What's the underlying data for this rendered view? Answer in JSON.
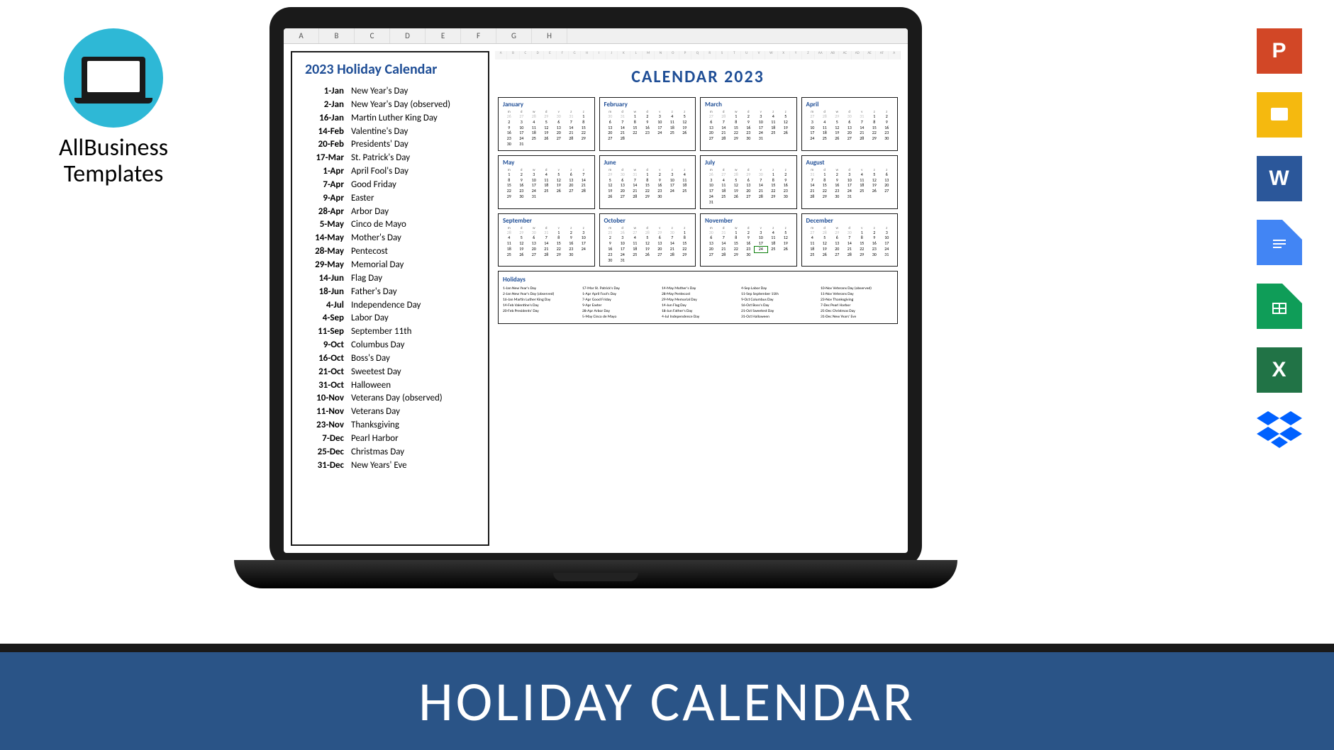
{
  "logo": {
    "line1": "AllBusiness",
    "line2": "Templates"
  },
  "banner": "HOLIDAY CALENDAR",
  "col_headers": [
    "A",
    "B",
    "C",
    "D",
    "E",
    "F",
    "G",
    "H"
  ],
  "holiday_panel": {
    "title": "2023 Holiday Calendar",
    "items": [
      {
        "date": "1-Jan",
        "name": "New Year's Day"
      },
      {
        "date": "2-Jan",
        "name": "New Year's Day (observed)"
      },
      {
        "date": "16-Jan",
        "name": "Martin Luther King Day"
      },
      {
        "date": "14-Feb",
        "name": "Valentine's Day"
      },
      {
        "date": "20-Feb",
        "name": "Presidents' Day"
      },
      {
        "date": "17-Mar",
        "name": "St. Patrick's Day"
      },
      {
        "date": "1-Apr",
        "name": "April Fool's Day"
      },
      {
        "date": "7-Apr",
        "name": "Good Friday"
      },
      {
        "date": "9-Apr",
        "name": "Easter"
      },
      {
        "date": "28-Apr",
        "name": "Arbor Day"
      },
      {
        "date": "5-May",
        "name": "Cinco de Mayo"
      },
      {
        "date": "14-May",
        "name": "Mother's Day"
      },
      {
        "date": "28-May",
        "name": "Pentecost"
      },
      {
        "date": "29-May",
        "name": "Memorial Day"
      },
      {
        "date": "14-Jun",
        "name": "Flag Day"
      },
      {
        "date": "18-Jun",
        "name": "Father's Day"
      },
      {
        "date": "4-Jul",
        "name": "Independence Day"
      },
      {
        "date": "4-Sep",
        "name": "Labor Day"
      },
      {
        "date": "11-Sep",
        "name": "September 11th"
      },
      {
        "date": "9-Oct",
        "name": "Columbus Day"
      },
      {
        "date": "16-Oct",
        "name": "Boss's Day"
      },
      {
        "date": "21-Oct",
        "name": "Sweetest Day"
      },
      {
        "date": "31-Oct",
        "name": "Halloween"
      },
      {
        "date": "10-Nov",
        "name": "Veterans Day (observed)"
      },
      {
        "date": "11-Nov",
        "name": "Veterans Day"
      },
      {
        "date": "23-Nov",
        "name": "Thanksgiving"
      },
      {
        "date": "7-Dec",
        "name": "Pearl Harbor"
      },
      {
        "date": "25-Dec",
        "name": "Christmas Day"
      },
      {
        "date": "31-Dec",
        "name": "New Years' Eve"
      }
    ]
  },
  "calendar": {
    "title": "CALENDAR 2023",
    "mini_cols": [
      "A",
      "B",
      "C",
      "D",
      "E",
      "F",
      "G",
      "H",
      "I",
      "J",
      "K",
      "L",
      "M",
      "N",
      "O",
      "P",
      "Q",
      "R",
      "S",
      "T",
      "U",
      "V",
      "W",
      "X",
      "Y",
      "Z",
      "AA",
      "AB",
      "AC",
      "AD",
      "AE",
      "AF",
      "A"
    ],
    "dow": [
      "m",
      "d",
      "w",
      "d",
      "v",
      "z",
      "z"
    ],
    "months": [
      {
        "name": "January",
        "offset": 6,
        "days": 31,
        "pre": [
          26,
          27,
          28,
          29,
          30,
          31
        ]
      },
      {
        "name": "February",
        "offset": 2,
        "days": 28,
        "pre": [
          30,
          31
        ]
      },
      {
        "name": "March",
        "offset": 2,
        "days": 31,
        "pre": [
          27,
          28
        ]
      },
      {
        "name": "April",
        "offset": 5,
        "days": 30,
        "pre": [
          27,
          28,
          29,
          30,
          31
        ]
      },
      {
        "name": "May",
        "offset": 0,
        "days": 31,
        "pre": []
      },
      {
        "name": "June",
        "offset": 3,
        "days": 30,
        "pre": [
          29,
          30,
          31
        ]
      },
      {
        "name": "July",
        "offset": 5,
        "days": 31,
        "pre": [
          26,
          27,
          28,
          29,
          30
        ]
      },
      {
        "name": "August",
        "offset": 1,
        "days": 31,
        "pre": [
          31
        ]
      },
      {
        "name": "September",
        "offset": 4,
        "days": 30,
        "pre": [
          28,
          29,
          30,
          31
        ]
      },
      {
        "name": "October",
        "offset": 6,
        "days": 31,
        "pre": [
          25,
          26,
          27,
          28,
          29,
          30
        ]
      },
      {
        "name": "November",
        "offset": 2,
        "days": 30,
        "pre": [
          30,
          31
        ],
        "selected": 24
      },
      {
        "name": "December",
        "offset": 4,
        "days": 31,
        "pre": [
          27,
          28,
          29,
          30
        ]
      }
    ],
    "holidays_label": "Holidays",
    "holidays_grid": [
      "1-Jan New Year's Day",
      "17-Mar St. Patrick's Day",
      "14-May Mother's Day",
      "4-Sep Labor Day",
      "10-Nov Veterans Day (observed)",
      "2-Jan New Year's Day (observed)",
      "1-Apr April Fool's Day",
      "28-May Pentecost",
      "11-Sep September 11th",
      "11-Nov Veterans Day",
      "16-Jan Martin Luther King Day",
      "7-Apr Good Friday",
      "29-May Memorial Day",
      "9-Oct Columbus Day",
      "23-Nov Thanksgiving",
      "14-Feb Valentine's Day",
      "9-Apr Easter",
      "14-Jun Flag Day",
      "16-Oct Boss's Day",
      "7-Dec Pearl Harbor",
      "20-Feb Presidents' Day",
      "28-Apr Arbor Day",
      "18-Jun Father's Day",
      "21-Oct Sweetest Day",
      "25-Dec Christmas Day",
      "",
      "5-May Cinco de Mayo",
      "4-Jul Independence Day",
      "31-Oct Halloween",
      "31-Dec New Years' Eve"
    ]
  },
  "icons": {
    "ppt": "P",
    "gslides": "",
    "word": "W",
    "gdocs": "",
    "gsheets": "",
    "excel": "X",
    "dropbox": ""
  }
}
